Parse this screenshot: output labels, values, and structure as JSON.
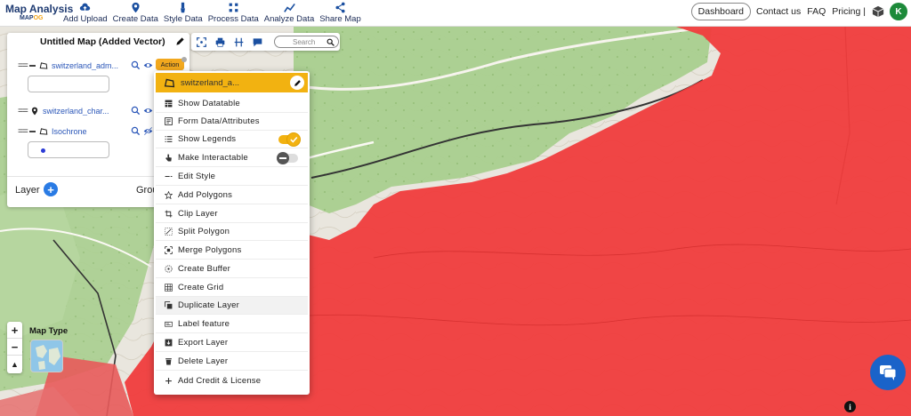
{
  "app": {
    "logo_title": "Map Analysis",
    "logo_sub_prefix": "MAP",
    "logo_sub_suffix": "OG"
  },
  "nav": [
    {
      "label": "Add Upload",
      "icon": "cloud-upload-icon"
    },
    {
      "label": "Create Data",
      "icon": "map-pin-icon"
    },
    {
      "label": "Style Data",
      "icon": "paint-brush-icon"
    },
    {
      "label": "Process Data",
      "icon": "process-nodes-icon"
    },
    {
      "label": "Analyze Data",
      "icon": "analyze-chart-icon"
    },
    {
      "label": "Share Map",
      "icon": "share-icon"
    }
  ],
  "right_nav": {
    "dashboard": "Dashboard",
    "contact": "Contact us",
    "faq": "FAQ",
    "pricing": "Pricing |",
    "avatar_initial": "K"
  },
  "panel": {
    "title": "Untitled Map (Added Vector)",
    "layers": [
      {
        "name": "switzerland_adm...",
        "icon": "polygon-icon"
      },
      {
        "name": "switzerland_char...",
        "icon": "pin-icon"
      },
      {
        "name": "Isochrone",
        "icon": "polygon-icon"
      }
    ],
    "layer_label": "Layer",
    "group_label": "Grou",
    "action_badge": "Action"
  },
  "toolbar": {
    "search_placeholder": "Search"
  },
  "dropdown": {
    "header": "switzerland_a...",
    "items": [
      {
        "label": "Show Datatable",
        "icon": "table-icon"
      },
      {
        "label": "Form Data/Attributes",
        "icon": "form-icon"
      },
      {
        "label": "Show Legends",
        "icon": "list-icon",
        "toggle": true
      },
      {
        "label": "Make Interactable",
        "icon": "hand-pointer-icon",
        "toggle": false
      },
      {
        "label": "Edit Style",
        "icon": "style-lines-icon"
      },
      {
        "label": "Add Polygons",
        "icon": "star-icon"
      },
      {
        "label": "Clip Layer",
        "icon": "crop-icon"
      },
      {
        "label": "Split Polygon",
        "icon": "split-icon"
      },
      {
        "label": "Merge Polygons",
        "icon": "merge-icon"
      },
      {
        "label": "Create Buffer",
        "icon": "buffer-icon"
      },
      {
        "label": "Create Grid",
        "icon": "grid-icon"
      },
      {
        "label": "Duplicate Layer",
        "icon": "duplicate-icon"
      },
      {
        "label": "Label feature",
        "icon": "label-icon"
      },
      {
        "label": "Export Layer",
        "icon": "export-icon"
      },
      {
        "label": "Delete Layer",
        "icon": "trash-icon"
      },
      {
        "label": "Add Credit & License",
        "icon": "plus-icon"
      }
    ]
  },
  "map_controls": {
    "zoom_in": "+",
    "zoom_out": "−",
    "reset": "▲",
    "map_type_label": "Map Type"
  },
  "colors": {
    "accent": "#f2b211",
    "isochrone": "#f03c3c",
    "brand": "#1f3b72",
    "link": "#2a56b8"
  }
}
